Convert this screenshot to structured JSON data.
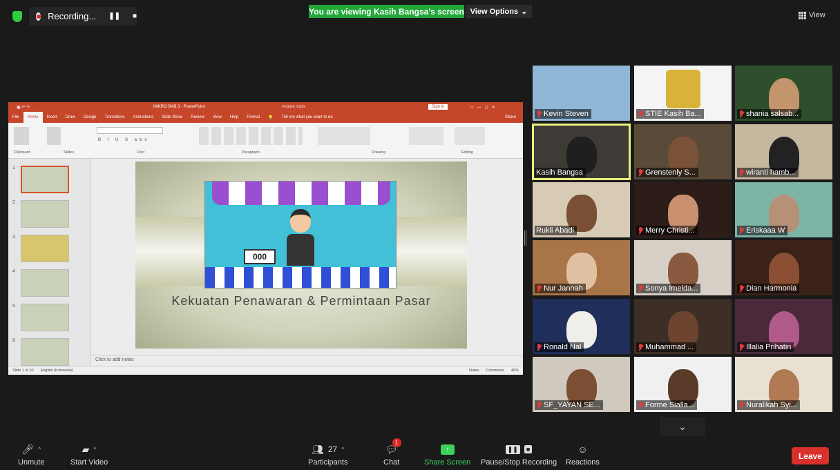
{
  "top": {
    "recording_label": "Recording...",
    "banner": "You are viewing Kasih Bangsa's screen",
    "view_options": "View Options",
    "view_button": "View"
  },
  "ppt": {
    "title": "MIKRO BAB 3 - PowerPoint",
    "picture_tools": "Picture Tools",
    "sign_in": "Sign in",
    "tabs": [
      "File",
      "Home",
      "Insert",
      "Draw",
      "Design",
      "Transitions",
      "Animations",
      "Slide Show",
      "Review",
      "View",
      "Help",
      "Format"
    ],
    "tell_me": "Tell me what you want to do",
    "share": "Share",
    "groups": [
      "Clipboard",
      "Slides",
      "Font",
      "Paragraph",
      "Drawing",
      "Editing"
    ],
    "slide_title": "Kekuatan Penawaran & Permintaan Pasar",
    "sign_text": "000",
    "notes_placeholder": "Click to add notes",
    "status_left": "Slide 1 of 10",
    "language": "English (Indonesia)",
    "notes_btn": "Notes",
    "comments_btn": "Comments",
    "zoom": "46%",
    "thumb_numbers": [
      "1",
      "2",
      "3",
      "4",
      "5",
      "6"
    ]
  },
  "participants": [
    {
      "name": "Kevin Steven",
      "bg": "#8fb6d6",
      "face": "none"
    },
    {
      "name": "STIE Kasih Ba...",
      "bg": "#f4f4f4",
      "face": "logo"
    },
    {
      "name": "shania salsab...",
      "bg": "#2f4f2c",
      "face": "#c2956c"
    },
    {
      "name": "Kasih Bangsa",
      "bg": "#3e3a35",
      "face": "#1f1f1f"
    },
    {
      "name": "Grenstenly S...",
      "bg": "#5a4a38",
      "face": "#7a5238"
    },
    {
      "name": "wiranti hamb...",
      "bg": "#c6b79f",
      "face": "#222"
    },
    {
      "name": "Rukli Abadi",
      "bg": "#d8cbb5",
      "face": "#7a5034"
    },
    {
      "name": "Merry Christi...",
      "bg": "#2e1c18",
      "face": "#c99070"
    },
    {
      "name": "Eriskaaa W",
      "bg": "#7eb3a8",
      "face": "#b59277"
    },
    {
      "name": "Nur Jannah",
      "bg": "#a97448",
      "face": "#e1c1a1"
    },
    {
      "name": "Sonya Imelda...",
      "bg": "#d8cfc6",
      "face": "#8a5a40"
    },
    {
      "name": "Dian Harmonia",
      "bg": "#3a2218",
      "face": "#8a4f33"
    },
    {
      "name": "Ronald Nal",
      "bg": "#1f2f5a",
      "face": "#f0eee8"
    },
    {
      "name": "Muhammad ...",
      "bg": "#3d2f25",
      "face": "#6c4430"
    },
    {
      "name": "Illalia Prihatin",
      "bg": "#4a2a3a",
      "face": "#b05a8a"
    },
    {
      "name": "SF_YAYAN SE...",
      "bg": "#d0c9bd",
      "face": "#7c4f34"
    },
    {
      "name": "Forme Sialla...",
      "bg": "#f0f0f0",
      "face": "#5a3b2a"
    },
    {
      "name": "Nuralikah Syi...",
      "bg": "#e8e1d2",
      "face": "#b07a54"
    }
  ],
  "toolbar": {
    "unmute": "Unmute",
    "start_video": "Start Video",
    "participants": "Participants",
    "participants_count": "27",
    "chat": "Chat",
    "chat_badge": "1",
    "share_screen": "Share Screen",
    "pause_recording": "Pause/Stop Recording",
    "reactions": "Reactions",
    "leave": "Leave"
  },
  "colors": {
    "banner": "#22a83a",
    "leave": "#d9302c",
    "speaker_outline": "#e6f27a",
    "ppt_accent": "#c6462a"
  }
}
